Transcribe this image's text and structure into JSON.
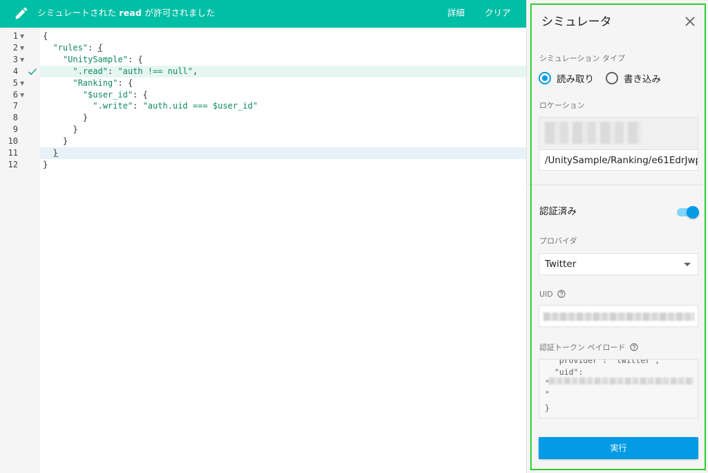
{
  "banner": {
    "message_prefix": "シミュレートされた ",
    "message_op": "read",
    "message_suffix": " が許可されました",
    "detail_label": "詳細",
    "clear_label": "クリア",
    "icon": "pencil-icon",
    "color": "#00bfa5"
  },
  "editor": {
    "lines": [
      {
        "num": "1",
        "fold": "▼",
        "tokens": [
          {
            "t": "{",
            "c": "p"
          }
        ]
      },
      {
        "num": "2",
        "fold": "▼",
        "tokens": [
          {
            "t": "  \"rules\"",
            "c": "s"
          },
          {
            "t": ": ",
            "c": "p"
          },
          {
            "t": "{",
            "c": "p",
            "u": true
          }
        ]
      },
      {
        "num": "3",
        "fold": "▼",
        "tokens": [
          {
            "t": "    \"UnitySample\"",
            "c": "s"
          },
          {
            "t": ": {",
            "c": "p"
          }
        ]
      },
      {
        "num": "4",
        "fold": "",
        "check": true,
        "highlight": "green",
        "tokens": [
          {
            "t": "      \".read\"",
            "c": "s"
          },
          {
            "t": ": ",
            "c": "p"
          },
          {
            "t": "\"auth !== null\"",
            "c": "s"
          },
          {
            "t": ",",
            "c": "p"
          }
        ]
      },
      {
        "num": "5",
        "fold": "▼",
        "tokens": [
          {
            "t": "      \"Ranking\"",
            "c": "s"
          },
          {
            "t": ": {",
            "c": "p"
          }
        ]
      },
      {
        "num": "6",
        "fold": "▼",
        "tokens": [
          {
            "t": "        \"$user_id\"",
            "c": "s"
          },
          {
            "t": ": {",
            "c": "p"
          }
        ]
      },
      {
        "num": "7",
        "fold": "",
        "tokens": [
          {
            "t": "          \".write\"",
            "c": "s"
          },
          {
            "t": ": ",
            "c": "p"
          },
          {
            "t": "\"auth.uid === $user_id\"",
            "c": "s"
          }
        ]
      },
      {
        "num": "8",
        "fold": "",
        "tokens": [
          {
            "t": "        }",
            "c": "p"
          }
        ]
      },
      {
        "num": "9",
        "fold": "",
        "tokens": [
          {
            "t": "      }",
            "c": "p"
          }
        ]
      },
      {
        "num": "10",
        "fold": "",
        "tokens": [
          {
            "t": "    }",
            "c": "p"
          }
        ]
      },
      {
        "num": "11",
        "fold": "",
        "highlight": "blue",
        "tokens": [
          {
            "t": "  ",
            "c": "p"
          },
          {
            "t": "}",
            "c": "p",
            "u": true
          }
        ]
      },
      {
        "num": "12",
        "fold": "",
        "tokens": [
          {
            "t": "}",
            "c": "p"
          }
        ]
      }
    ]
  },
  "simulator": {
    "title": "シミュレータ",
    "close_icon": "close-icon",
    "sim_type_label": "シミュレーション タイプ",
    "radio_read": "読み取り",
    "radio_write": "書き込み",
    "selected_type": "read",
    "location_label": "ロケーション",
    "location_value": "/UnitySample/Ranking/e61EdrJwp",
    "authenticated_label": "認証済み",
    "authenticated": true,
    "provider_label": "プロバイダ",
    "provider_value": "Twitter",
    "uid_label": "UID",
    "payload_label": "認証トークン ペイロード",
    "payload_lines": [
      "  \"provider\": \"twitter\",",
      "  \"uid\":",
      "\"",
      "\"",
      "}"
    ],
    "run_label": "実行",
    "accent": "#039be5",
    "outline_color": "#2ad02a"
  }
}
